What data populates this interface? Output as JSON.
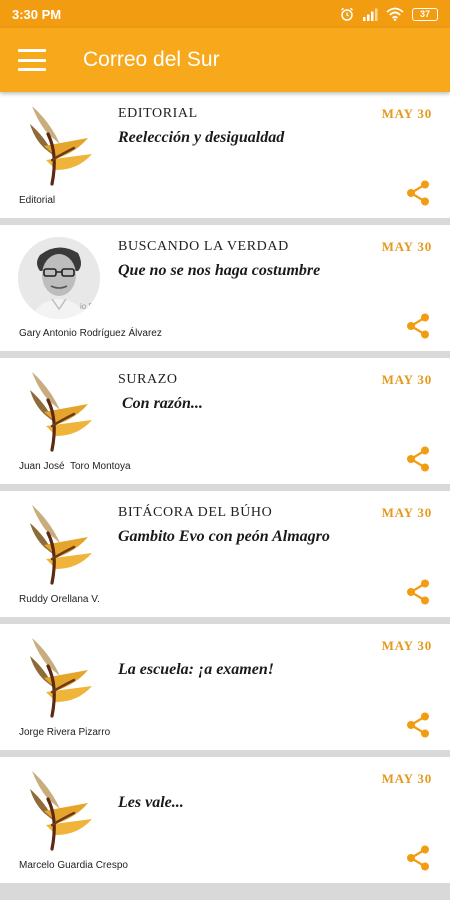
{
  "status_bar": {
    "time": "3:30 PM",
    "battery": "37"
  },
  "app_bar": {
    "title": "Correo del Sur"
  },
  "colors": {
    "accent": "#f7a81b",
    "status": "#f29c11",
    "date": "#e39a1f"
  },
  "articles": [
    {
      "section": "EDITORIAL",
      "headline": "Reelección y desigualdad",
      "author": "Editorial",
      "date": "MAY 30",
      "thumb": "logo"
    },
    {
      "section": "BUSCANDO LA VERDAD",
      "headline": "Que no se nos haga costumbre",
      "author": "Gary Antonio Rodríguez Álvarez",
      "date": "MAY 30",
      "thumb": "portrait"
    },
    {
      "section": "SURAZO",
      "headline": " Con razón...",
      "author": "Juan José  Toro Montoya",
      "date": "MAY 30",
      "thumb": "logo"
    },
    {
      "section": "BITÁCORA DEL BÚHO",
      "headline": "Gambito Evo con peón Almagro",
      "author": "Ruddy Orellana V.",
      "date": "MAY 30",
      "thumb": "logo"
    },
    {
      "section": "",
      "headline": "La escuela: ¡a examen!",
      "author": "Jorge Rivera Pizarro",
      "date": "MAY 30",
      "thumb": "logo"
    },
    {
      "section": "",
      "headline": "Les vale...",
      "author": "Marcelo Guardia Crespo",
      "date": "MAY 30",
      "thumb": "logo"
    }
  ],
  "icons": {
    "menu": "hamburger-menu-icon",
    "share": "share-icon",
    "logo": "correo-del-sur-logo"
  }
}
